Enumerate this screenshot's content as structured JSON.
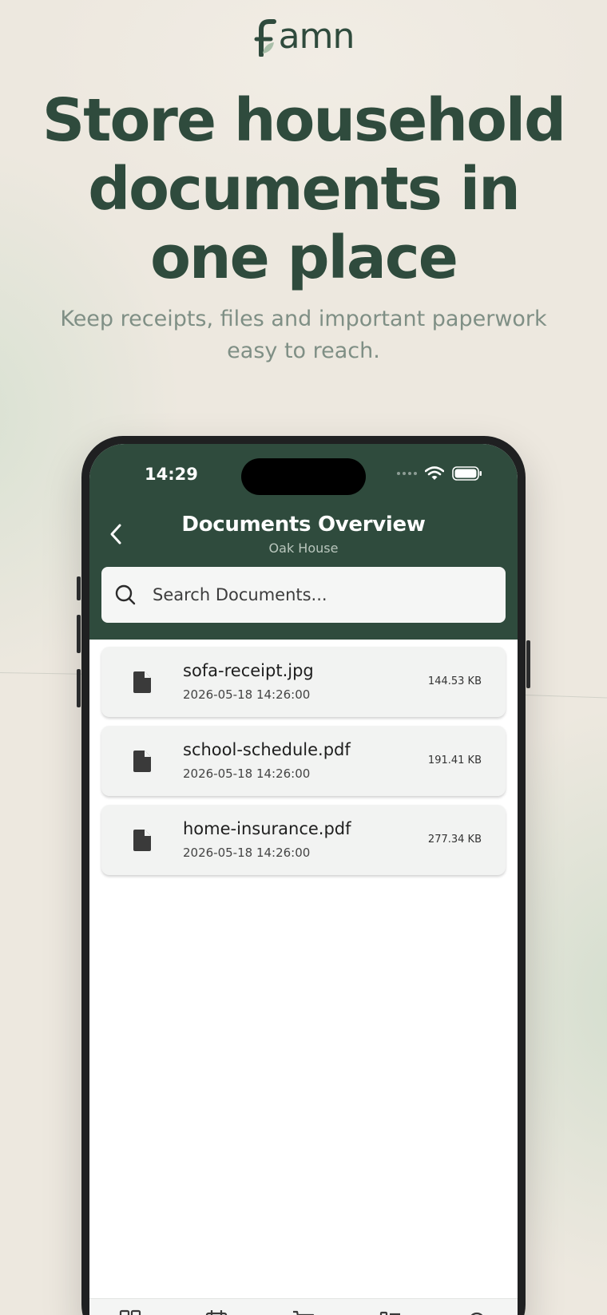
{
  "brand": {
    "logo_text": "amn",
    "primary_color": "#2f4b3d"
  },
  "hero": {
    "headline_lines": [
      "Store household",
      "documents in",
      "one place"
    ],
    "subline_lines": [
      "Keep receipts, files and important paperwork",
      "easy to reach."
    ]
  },
  "status_bar": {
    "time": "14:29"
  },
  "nav": {
    "title": "Documents Overview",
    "subtitle": "Oak House",
    "back_icon": "chevron-left-icon"
  },
  "search": {
    "placeholder": "Search Documents..."
  },
  "documents": [
    {
      "name": "sofa-receipt.jpg",
      "date": "2026-05-18 14:26:00",
      "size": "144.53 KB",
      "icon": "file-icon"
    },
    {
      "name": "school-schedule.pdf",
      "date": "2026-05-18 14:26:00",
      "size": "191.41 KB",
      "icon": "file-icon"
    },
    {
      "name": "home-insurance.pdf",
      "date": "2026-05-18 14:26:00",
      "size": "277.34 KB",
      "icon": "file-icon"
    }
  ],
  "tab_bar": {
    "icons": [
      "dashboard-icon",
      "calendar-icon",
      "cart-icon",
      "list-icon",
      "settings-icon"
    ]
  }
}
